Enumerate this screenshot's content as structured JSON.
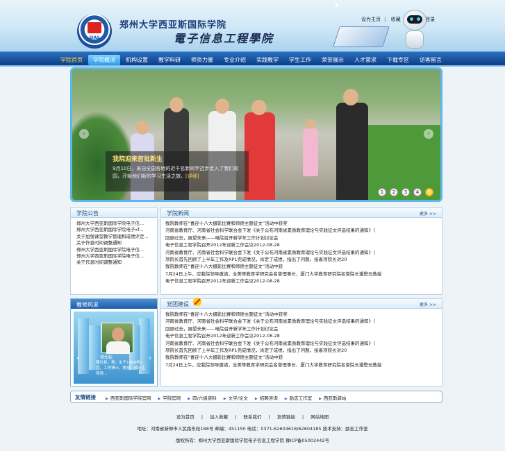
{
  "header": {
    "logo_text": "SIAS",
    "school_name": "郑州大学西亚斯国际学院",
    "dept_name": "電子信息工程學院",
    "top_links": [
      "设为主页",
      "收藏",
      "管理员登录"
    ]
  },
  "nav": {
    "items": [
      "学院首页",
      "学院概况",
      "机构设置",
      "教学科研",
      "师资力量",
      "专业介绍",
      "实践教学",
      "学生工作",
      "荣誉展示",
      "人才需求",
      "下载专区",
      "访客留言"
    ]
  },
  "banner": {
    "title": "我院迎来首批新生",
    "text": "9月10日，来自全国各地的近千名新同学迈步走入了我们校园，开始他们新的学习生活之旅。",
    "more": "[详细]",
    "pages": [
      "1",
      "2",
      "3",
      "4",
      "5"
    ],
    "prev": "‹",
    "next": "›"
  },
  "announce": {
    "title": "学院公告",
    "items": [
      "郑州大学西亚斯国际学院电子信...",
      "郑州大学西亚斯国际学院电子xf...",
      "关于加强课堂教学管理和成绩评定...",
      "关于作息时间调整通知",
      "郑州大学西亚斯国际学院电子信...",
      "郑州大学西亚斯国际学院电子信...",
      "关于作息时间调整通知"
    ]
  },
  "college_news": {
    "title": "学院新闻",
    "more": "更多 >>",
    "items": [
      "我院教师在“喜迎十八大摄影比赛和师德主题征文”活动中获奖",
      "河南省教育厅、河南省社会科学联合会下发《关于公布河南省素质教育理论与实践征文评选结果的通知》（",
      "回顾过去，展望未来——电院召开新学年工作计划讨论会",
      "电子信息工程学院召开2012年迎新工作会议2012-08-28",
      "河南省教育厅、河南省社会科学联合会下发《关于公布河南省素质教育理论与实践征文评选结果的通知》（",
      "项院长首先回顾了上半年工作及RP1完成情况，肯定了成绩，指出了问题，接着项院长对20",
      "我院教师在“喜迎十八大摄影比赛和师德主题征文”活动中获",
      "7月24日上午，应我院领导邀请，全美等教育学研究会名誉理事长、厦门大学教育研究院名誉院长潘懋元教授",
      "电子信息工程学院召开2012年迎新工作会议2012-08-28"
    ]
  },
  "teacher": {
    "title": "教师风采",
    "name": "项仕标",
    "desc": "项仕标，男，生于1949年5月，工学博士，教授，硕士生导师..."
  },
  "party": {
    "title": "党团建设",
    "more": "更多 >>",
    "items": [
      "我院教师在“喜迎十八大摄影比赛和师德主题征文”活动中获奖",
      "河南省教育厅、河南省社会科学联合会下发《关于公布河南省素质教育理论与实践征文评选结果的通知》（",
      "回顾过去，展望未来——电院召开新学年工作计划讨论会",
      "电子信息工程学院召开2012年迎新工作会议2012-08-28",
      "河南省教育厅、河南省社会科学联合会下发《关于公布河南省素质教育理论与实践征文评选结果的通知》（",
      "项院长首先回顾了上半年工作及RP1完成情况，肯定了成绩，指出了问题，接着项院长对20",
      "我院教师在“喜迎十八大摄影比赛和师德主题征文”活动中获",
      "7月24日上午，应我院领导邀请，全美等教育学研究会名誉理事长、厦门大学教育研究院名誉院长潘懋元教授"
    ]
  },
  "links": {
    "title": "友情链接",
    "items": [
      "西亚斯国际学院官网",
      "学院官网",
      "四/六级资料",
      "文学/论文",
      "招聘咨询",
      "励志工作室",
      "西亚斯驿站"
    ]
  },
  "footer": {
    "nav": [
      "设为首页",
      "|",
      "加入收藏",
      "|",
      "联系我们",
      "|",
      "友情链接",
      "|",
      "网站地图"
    ],
    "address": "地址：河南省新郑市人民路东段168号  邮编：451150  电话：0371-62604618/62604185  技术支持：励志工作室",
    "copyright": "版权所有：郑州大学西亚斯国际学院电子信息工程学院  豫ICP备05002442号"
  },
  "colors": {
    "nav": "#0d3d86",
    "accent": "#5ab9ea",
    "highlight": "#ffd24a"
  }
}
